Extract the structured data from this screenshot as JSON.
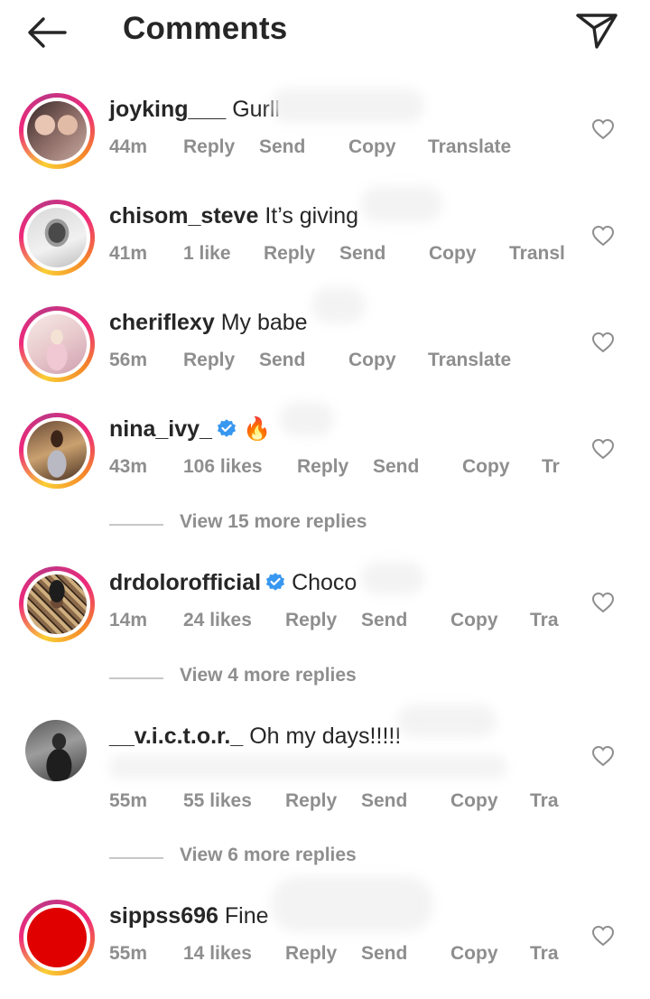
{
  "header": {
    "title": "Comments",
    "back_icon": "arrow-left-icon",
    "send_icon": "paper-plane-icon"
  },
  "comments": [
    {
      "username": "joyking___",
      "text": "Gurll",
      "verified": false,
      "time": "44m",
      "likes": "",
      "actions": [
        "Reply",
        "Send",
        "Copy",
        "Translate"
      ]
    },
    {
      "username": "chisom_steve",
      "text": "It’s giving",
      "verified": false,
      "time": "41m",
      "likes": "1 like",
      "actions": [
        "Reply",
        "Send",
        "Copy",
        "Transl"
      ]
    },
    {
      "username": "cheriflexy",
      "text": "My babe",
      "verified": false,
      "time": "56m",
      "likes": "",
      "actions": [
        "Reply",
        "Send",
        "Copy",
        "Translate"
      ]
    },
    {
      "username": "nina_ivy_",
      "text": "🔥",
      "verified": true,
      "time": "43m",
      "likes": "106 likes",
      "actions": [
        "Reply",
        "Send",
        "Copy",
        "Tr"
      ]
    },
    {
      "username": "drdolorofficial",
      "text": "Choco",
      "verified": true,
      "time": "14m",
      "likes": "24 likes",
      "actions": [
        "Reply",
        "Send",
        "Copy",
        "Tra"
      ]
    },
    {
      "username": "__v.i.c.t.o.r._",
      "text": "Oh my days!!!!!",
      "verified": false,
      "time": "55m",
      "likes": "55 likes",
      "actions": [
        "Reply",
        "Send",
        "Copy",
        "Tra"
      ]
    },
    {
      "username": "sippss696",
      "text": "Fine",
      "verified": false,
      "time": "55m",
      "likes": "14 likes",
      "actions": [
        "Reply",
        "Send",
        "Copy",
        "Tra"
      ]
    }
  ],
  "view_more": [
    "View 15 more replies",
    "View 4 more replies",
    "View 6 more replies"
  ],
  "colors": {
    "text": "#262626",
    "muted": "#8e8e8e",
    "verified": "#3897f0",
    "story_ring": "#ee2a7b"
  }
}
